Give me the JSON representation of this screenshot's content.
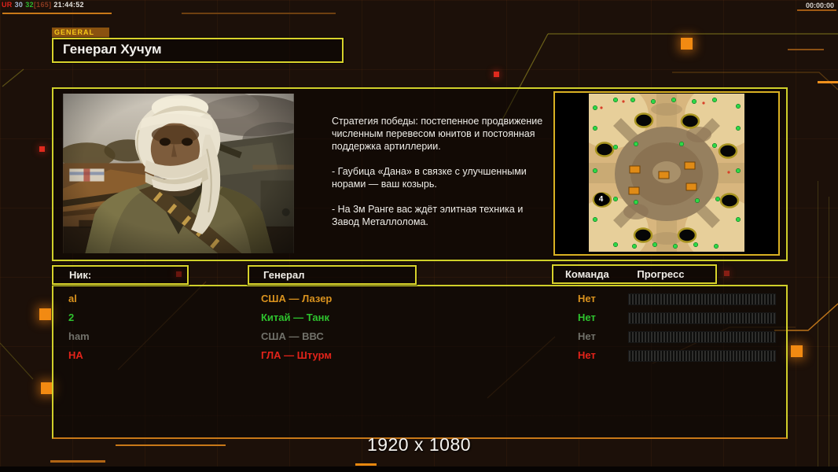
{
  "hud": {
    "netstats": {
      "ur": "UR",
      "a": "30",
      "b": "32",
      "c": "[165]",
      "time": "21:44:52"
    },
    "match_timer": "00:00:00"
  },
  "header": {
    "tab": "GENERAL",
    "title": "Генерал Хучум"
  },
  "briefing": {
    "paragraphs": [
      "Стратегия победы: постепенное продвижение численным перевесом юнитов и постоянная поддержка артиллерии.",
      "- Гаубица «Дана» в связке с улучшенными норами — ваш козырь.",
      "- На 3м Ранге вас ждёт элитная техника и Завод Металлолома."
    ]
  },
  "minimap": {
    "start_badge": "4"
  },
  "table": {
    "headers": {
      "nick": "Ник:",
      "general": "Генерал",
      "team": "Команда",
      "progress": "Прогресс"
    },
    "rows": [
      {
        "nick": "al",
        "general": "США — Лазер",
        "team": "Нет",
        "color": "#d9921e",
        "progress": 0
      },
      {
        "nick": "2",
        "general": "Китай — Танк",
        "team": "Нет",
        "color": "#2ec22e",
        "progress": 0
      },
      {
        "nick": "ham",
        "general": "США — ВВС",
        "team": "Нет",
        "color": "#71716a",
        "progress": 0
      },
      {
        "nick": "НА",
        "general": "ГЛА — Штурм",
        "team": "Нет",
        "color": "#e3231a",
        "progress": 0
      }
    ]
  },
  "footer": {
    "resolution": "1920 x 1080"
  },
  "colors": {
    "background": "#1c1009",
    "panel_border_yellow": "#d8d22b",
    "minimap_border": "#d8b022",
    "accent_orange": "#f28a12",
    "accent_red": "#e02a1e",
    "tab_bg": "#8a5210",
    "tab_text": "#f7c919"
  }
}
